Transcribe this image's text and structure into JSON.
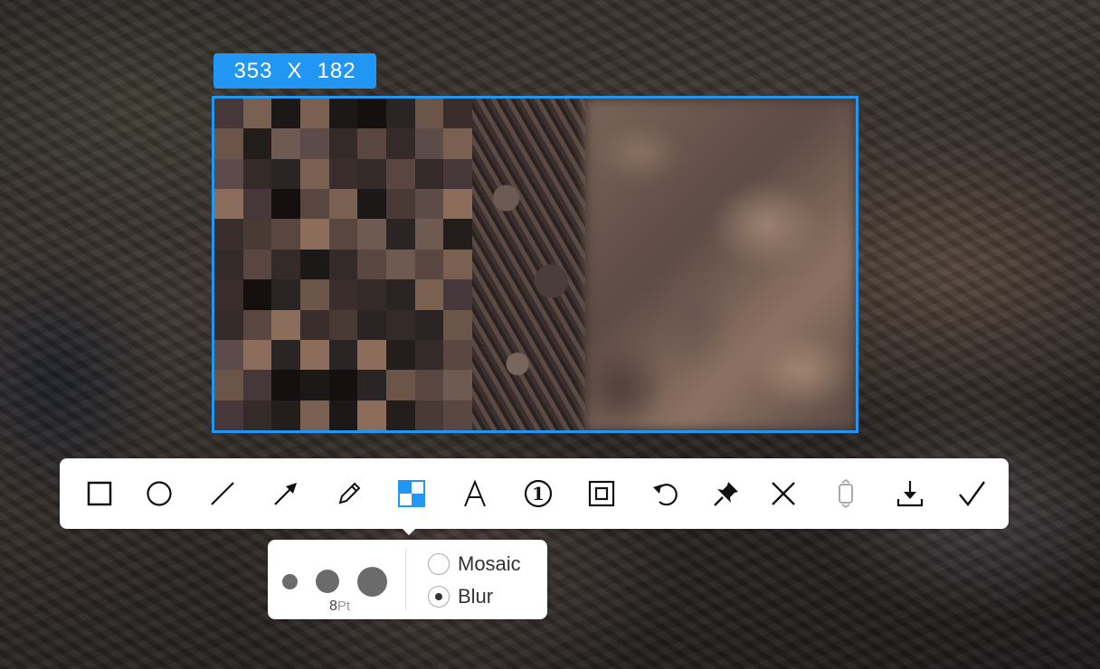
{
  "capture": {
    "width": "353",
    "separator": "X",
    "height": "182"
  },
  "toolbar": {
    "tools": [
      {
        "name": "rectangle-tool",
        "icon": "rectangle-icon"
      },
      {
        "name": "ellipse-tool",
        "icon": "circle-icon"
      },
      {
        "name": "line-tool",
        "icon": "line-icon"
      },
      {
        "name": "arrow-tool",
        "icon": "arrow-icon"
      },
      {
        "name": "pencil-tool",
        "icon": "pencil-icon"
      },
      {
        "name": "mosaic-tool",
        "icon": "mosaic-icon",
        "active": true
      },
      {
        "name": "text-tool",
        "icon": "text-icon",
        "glyph": "A"
      },
      {
        "name": "number-tool",
        "icon": "number-icon",
        "glyph": "1"
      },
      {
        "name": "border-tool",
        "icon": "border-icon"
      },
      {
        "name": "undo-button",
        "icon": "undo-icon"
      },
      {
        "name": "pin-button",
        "icon": "pin-icon"
      },
      {
        "name": "cancel-button",
        "icon": "close-icon"
      },
      {
        "name": "long-screenshot-button",
        "icon": "scroll-capture-icon",
        "disabled": true
      },
      {
        "name": "save-button",
        "icon": "download-icon"
      },
      {
        "name": "confirm-button",
        "icon": "checkmark-icon"
      }
    ],
    "accent_color": "#2196f3"
  },
  "options": {
    "brush_sizes": [
      "small",
      "medium",
      "large"
    ],
    "selected_size_value": "8",
    "selected_size_unit": "Pt",
    "modes": [
      {
        "label": "Mosaic",
        "selected": false
      },
      {
        "label": "Blur",
        "selected": true
      }
    ]
  }
}
